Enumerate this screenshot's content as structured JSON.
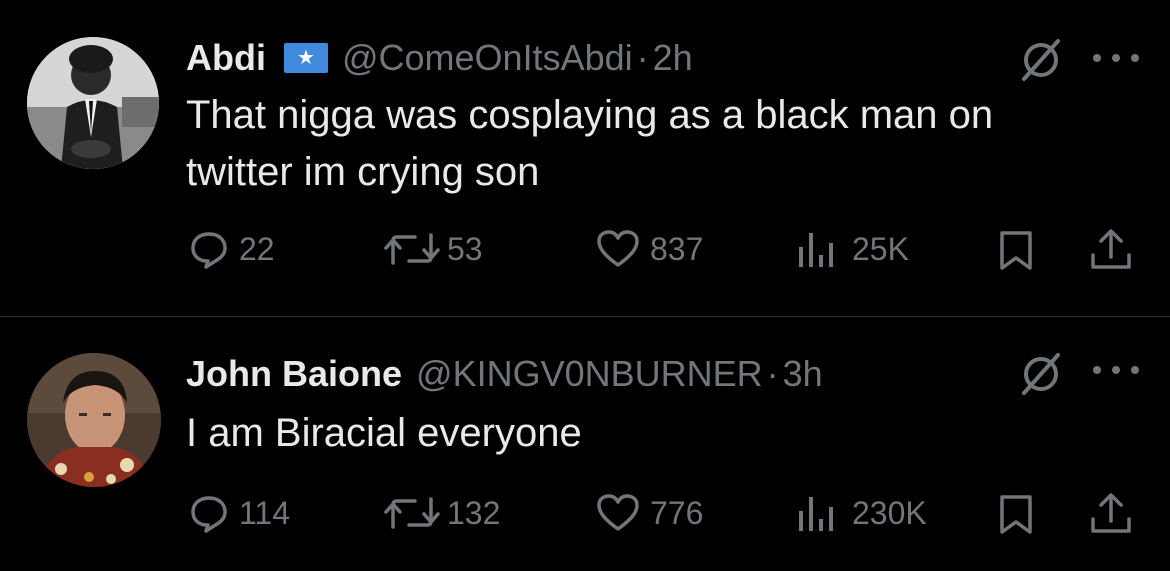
{
  "tweets": [
    {
      "name": "Abdi",
      "handle": "@ComeOnItsAbdi",
      "separator": "·",
      "time": "2h",
      "flag_symbol": "★",
      "text": "That nigga was cosplaying as a black man on\ntwitter im crying son",
      "replies": "22",
      "retweets": "53",
      "likes": "837",
      "views": "25K"
    },
    {
      "name": "John Baione",
      "handle": "@KINGV0NBURNER",
      "separator": "·",
      "time": "3h",
      "text": "I am Biracial everyone",
      "replies": "114",
      "retweets": "132",
      "likes": "776",
      "views": "230K"
    }
  ],
  "colors": {
    "background": "#000000",
    "text_primary": "#e7e9ea",
    "text_secondary": "#71767b",
    "divider": "#2f3336",
    "flag_blue": "#4189dd"
  },
  "icons": [
    "reply-icon",
    "retweet-icon",
    "like-icon",
    "views-icon",
    "bookmark-icon",
    "share-icon",
    "grok-icon",
    "more-icon",
    "somalia-flag-icon"
  ]
}
